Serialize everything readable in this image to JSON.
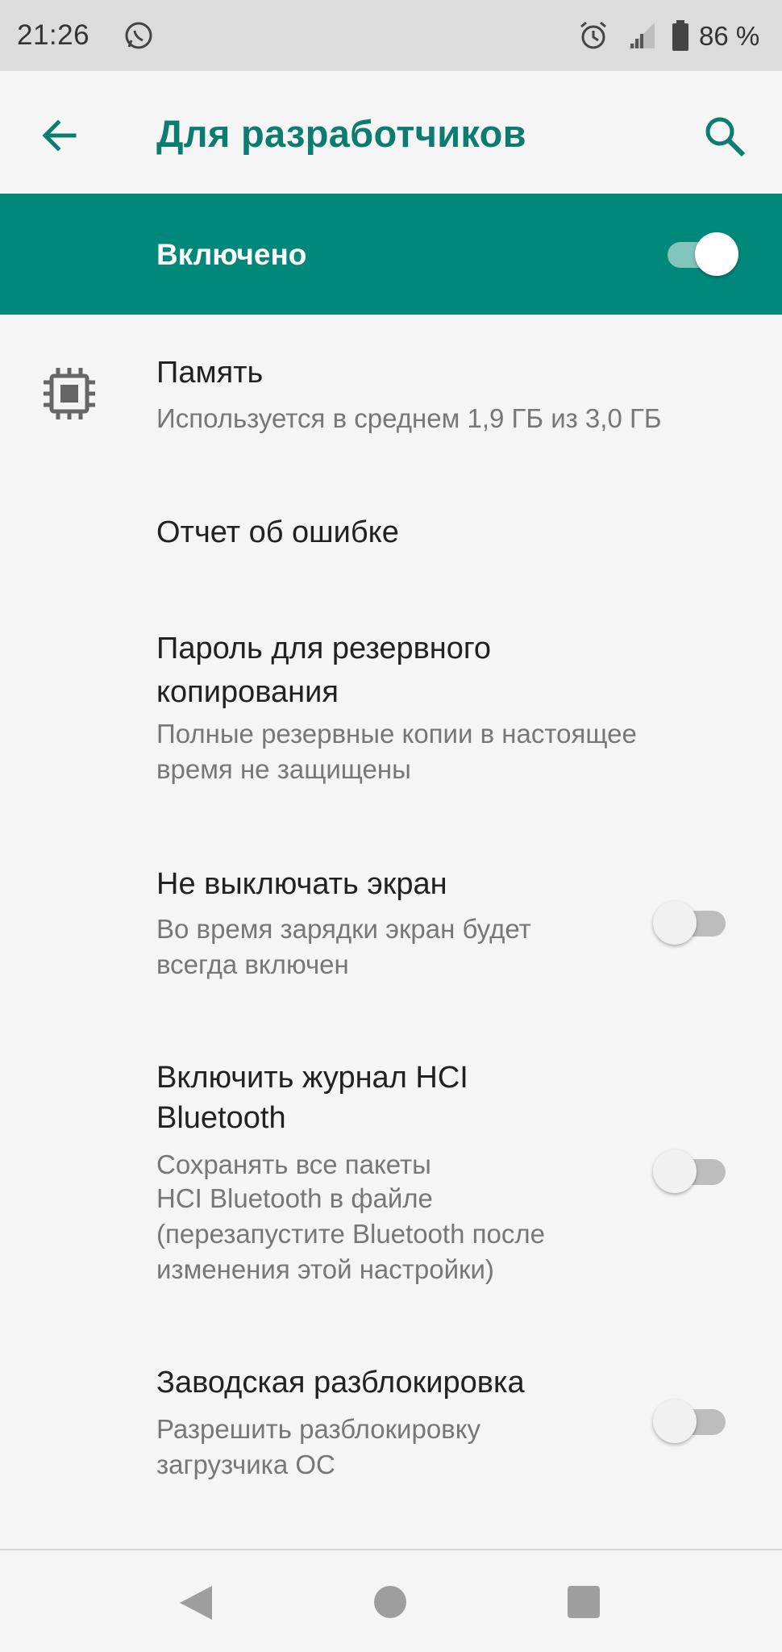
{
  "status_bar": {
    "time": "21:26",
    "battery_percent": "86 %",
    "icons": [
      "whatsapp-icon",
      "alarm-icon",
      "signal-icon",
      "battery-icon"
    ]
  },
  "toolbar": {
    "title": "Для разработчиков",
    "back_icon": "arrow-back-icon",
    "search_icon": "search-icon"
  },
  "master": {
    "label": "Включено",
    "enabled": true
  },
  "items": [
    {
      "title": "Память",
      "subtitle": "Используется в среднем 1,9 ГБ из 3,0 ГБ",
      "icon": "memory-chip-icon"
    },
    {
      "title": "Отчет об ошибке"
    },
    {
      "title_line1": "Пароль для резервного",
      "title_line2": "копирования",
      "subtitle_line1": "Полные резервные копии в настоящее",
      "subtitle_line2": "время не защищены"
    },
    {
      "title": "Не выключать экран",
      "subtitle_line1": "Во время зарядки экран будет",
      "subtitle_line2": "всегда включен",
      "enabled": false
    },
    {
      "title_line1": "Включить журнал HCI",
      "title_line2": "Bluetooth",
      "subtitle_line1": "Сохранять все пакеты",
      "subtitle_line2": "HCI Bluetooth в файле",
      "subtitle_line3": "(перезапустите Bluetooth после",
      "subtitle_line4": "изменения этой настройки)",
      "enabled": false
    },
    {
      "title": "Заводская разблокировка",
      "subtitle_line1": "Разрешить разблокировку",
      "subtitle_line2": "загрузчика ОС",
      "enabled": false
    }
  ],
  "colors": {
    "accent": "#00897b",
    "title_accent": "#0b7d6e",
    "status_bar_bg": "#dcdcdc",
    "background": "#f5f5f5"
  },
  "nav_bar": {
    "icons": [
      "nav-back-icon",
      "nav-home-icon",
      "nav-recents-icon"
    ]
  }
}
